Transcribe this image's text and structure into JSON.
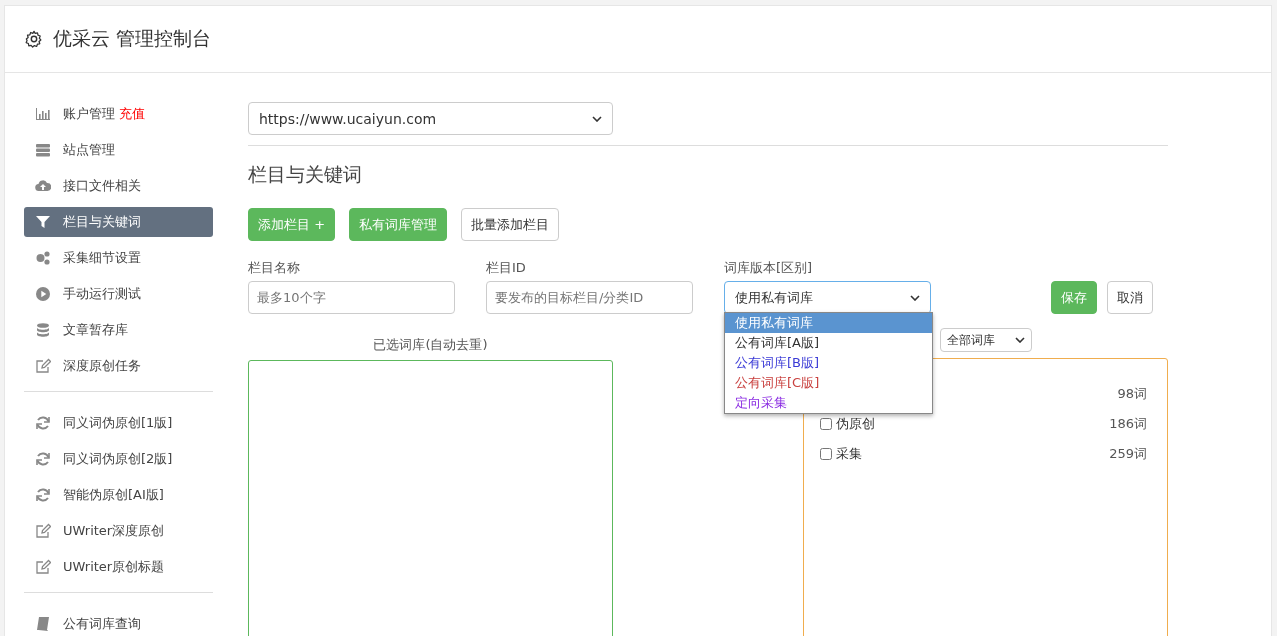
{
  "header": {
    "title": "优采云 管理控制台"
  },
  "sidebar": {
    "groups": [
      {
        "items": [
          {
            "label": "账户管理",
            "badge": "充值",
            "selected": false
          },
          {
            "label": "站点管理",
            "selected": false
          },
          {
            "label": "接口文件相关",
            "selected": false
          },
          {
            "label": "栏目与关键词",
            "selected": true
          },
          {
            "label": "采集细节设置",
            "selected": false
          },
          {
            "label": "手动运行测试",
            "selected": false
          },
          {
            "label": "文章暂存库",
            "selected": false
          },
          {
            "label": "深度原创任务",
            "selected": false
          }
        ]
      },
      {
        "items": [
          {
            "label": "同义词伪原创[1版]",
            "selected": false
          },
          {
            "label": "同义词伪原创[2版]",
            "selected": false
          },
          {
            "label": "智能伪原创[AI版]",
            "selected": false
          },
          {
            "label": "UWriter深度原创",
            "selected": false
          },
          {
            "label": "UWriter原创标题",
            "selected": false
          }
        ]
      },
      {
        "items": [
          {
            "label": "公有词库查询",
            "selected": false
          }
        ]
      }
    ]
  },
  "site_select": {
    "value": "https://www.ucaiyun.com"
  },
  "section_title": "栏目与关键词",
  "toolbar": [
    {
      "label": "添加栏目 +",
      "kind": "primary"
    },
    {
      "label": "私有词库管理",
      "kind": "primary"
    },
    {
      "label": "批量添加栏目",
      "kind": "default"
    }
  ],
  "form": {
    "name_label": "栏目名称",
    "name_placeholder": "最多10个字",
    "id_label": "栏目ID",
    "id_placeholder": "要发布的目标栏目/分类ID",
    "version_label": "词库版本[区别]",
    "version_value": "使用私有词库",
    "save": "保存",
    "cancel": "取消"
  },
  "version_options": [
    {
      "label": "使用私有词库",
      "selected": true
    },
    {
      "label": "公有词库[A版]",
      "color": "#333333",
      "selected": false
    },
    {
      "label": "公有词库[B版]",
      "color": "#3b3bd6",
      "selected": false
    },
    {
      "label": "公有词库[C版]",
      "color": "#c9413f",
      "selected": false
    },
    {
      "label": "定向采集",
      "color": "#8a2be2",
      "selected": false
    }
  ],
  "selected_panel": {
    "title": "已选词库(自动去重)"
  },
  "library_panel": {
    "filter": "全部词库",
    "rows": [
      {
        "count": "98词"
      },
      {
        "label": "伪原创",
        "count": "186词",
        "checked": false
      },
      {
        "label": "采集",
        "count": "259词",
        "checked": false
      }
    ]
  }
}
